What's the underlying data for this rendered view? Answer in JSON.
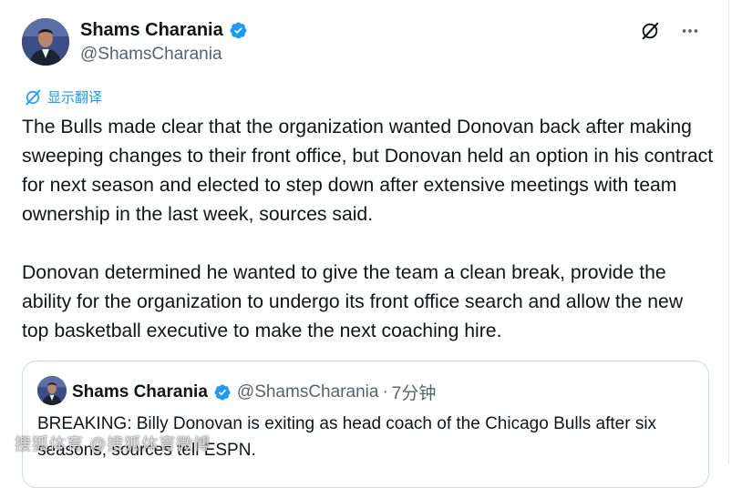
{
  "tweet": {
    "author_name": "Shams Charania",
    "author_handle": "@ShamsCharania",
    "translate_label": "显示翻译",
    "text": "The Bulls made clear that the organization wanted Donovan back after making sweeping changes to their front office, but Donovan held an option in his contract for next season and elected to step down after extensive meetings with team ownership in the last week, sources said.\n\nDonovan determined he wanted to give the team a clean break, provide the ability for the organization to undergo its front office search and allow the new top basketball executive to make the next coaching hire."
  },
  "quote": {
    "author_name": "Shams Charania",
    "author_handle": "@ShamsCharania",
    "separator": "·",
    "time": "7分钟",
    "text": "BREAKING: Billy Donovan is exiting as head coach of the Chicago Bulls after six seasons, sources tell ESPN."
  },
  "watermark": {
    "text": "搜狐体育 @搜狐体育微博"
  },
  "icons": {
    "verified_color": "#1d9bf0",
    "link_color": "#1d9bf0",
    "grok": "grok-icon",
    "more": "more-options-icon",
    "translate": "translate-icon"
  }
}
